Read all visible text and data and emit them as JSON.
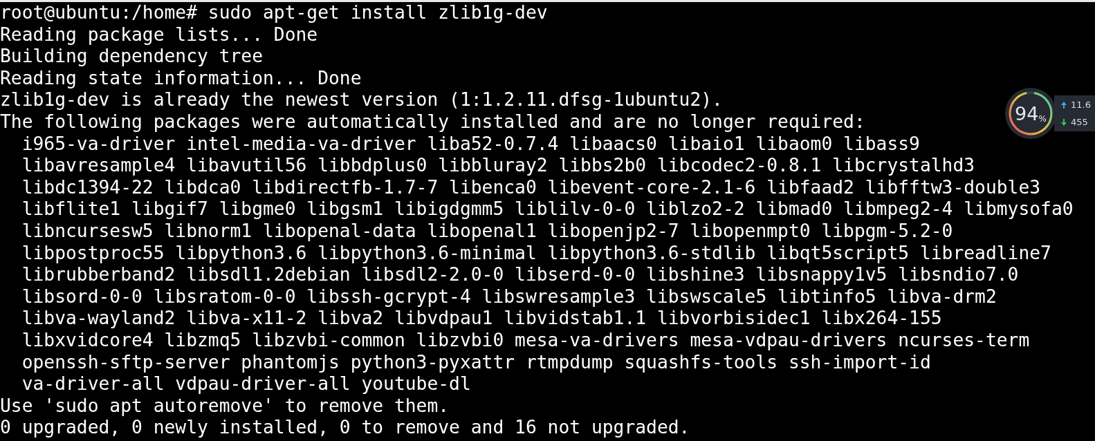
{
  "terminal": {
    "lines": [
      "root@ubuntu:/home# sudo apt-get install zlib1g-dev",
      "Reading package lists... Done",
      "Building dependency tree",
      "Reading state information... Done",
      "zlib1g-dev is already the newest version (1:1.2.11.dfsg-1ubuntu2).",
      "The following packages were automatically installed and are no longer required:",
      "  i965-va-driver intel-media-va-driver liba52-0.7.4 libaacs0 libaio1 libaom0 libass9",
      "  libavresample4 libavutil56 libbdplus0 libbluray2 libbs2b0 libcodec2-0.8.1 libcrystalhd3",
      "  libdc1394-22 libdca0 libdirectfb-1.7-7 libenca0 libevent-core-2.1-6 libfaad2 libfftw3-double3",
      "  libflite1 libgif7 libgme0 libgsm1 libigdgmm5 liblilv-0-0 liblzo2-2 libmad0 libmpeg2-4 libmysofa0",
      "  libncursesw5 libnorm1 libopenal-data libopenal1 libopenjp2-7 libopenmpt0 libpgm-5.2-0",
      "  libpostproc55 libpython3.6 libpython3.6-minimal libpython3.6-stdlib libqt5script5 libreadline7",
      "  librubberband2 libsdl1.2debian libsdl2-2.0-0 libserd-0-0 libshine3 libsnappy1v5 libsndio7.0",
      "  libsord-0-0 libsratom-0-0 libssh-gcrypt-4 libswresample3 libswscale5 libtinfo5 libva-drm2",
      "  libva-wayland2 libva-x11-2 libva2 libvdpau1 libvidstab1.1 libvorbisidec1 libx264-155",
      "  libxvidcore4 libzmq5 libzvbi-common libzvbi0 mesa-va-drivers mesa-vdpau-drivers ncurses-term",
      "  openssh-sftp-server phantomjs python3-pyxattr rtmpdump squashfs-tools ssh-import-id",
      "  va-driver-all vdpau-driver-all youtube-dl",
      "Use 'sudo apt autoremove' to remove them.",
      "0 upgraded, 0 newly installed, 0 to remove and 16 not upgraded."
    ]
  },
  "monitor": {
    "percent": "94",
    "unit": "%",
    "level": 0.94,
    "upload": "11.6",
    "download": "455"
  }
}
